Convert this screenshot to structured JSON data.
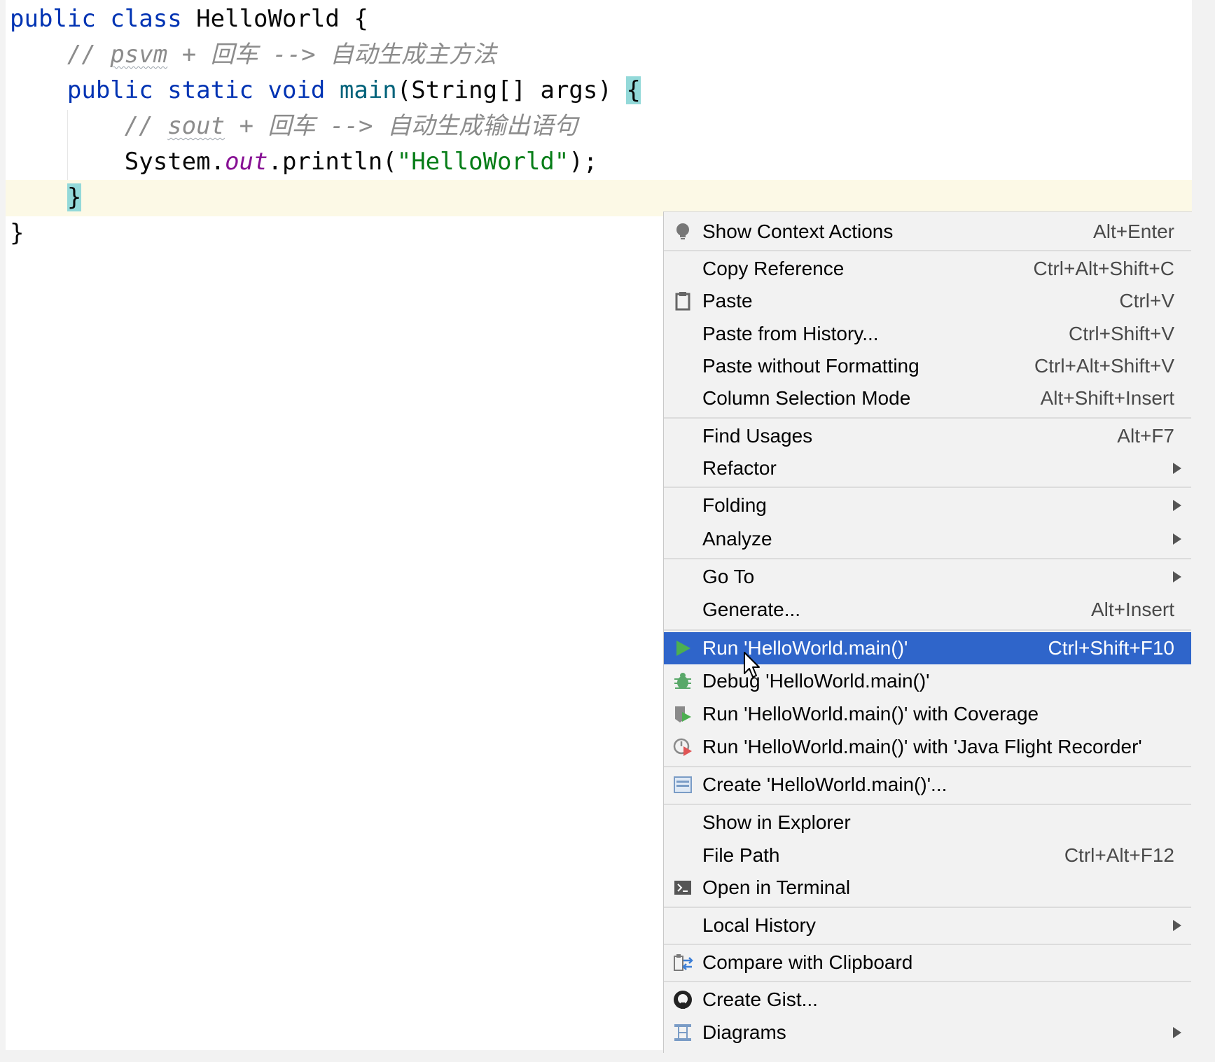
{
  "code": {
    "line1": {
      "kw1": "public",
      "kw2": "class",
      "name": "HelloWorld",
      "brace": "{"
    },
    "line2": {
      "slashes": "//",
      "word": "psvm",
      "plus": "+",
      "cjk1": "回车",
      "arrow": "-->",
      "cjk2": "自动生成主方法"
    },
    "line3": {
      "kw1": "public",
      "kw2": "static",
      "kw3": "void",
      "fn": "main",
      "params": "(String[] args)",
      "brace": "{"
    },
    "line4": {
      "slashes": "//",
      "word": "sout",
      "plus": "+",
      "cjk1": "回车",
      "arrow": "-->",
      "cjk2": "自动生成输出语句"
    },
    "line5": {
      "obj": "System.",
      "field": "out",
      "call": ".println(",
      "str": "\"HelloWorld\"",
      "end": ");"
    },
    "line6": {
      "brace": "}"
    },
    "line7": {
      "brace": "}"
    }
  },
  "context_menu": {
    "items": [
      {
        "label": "Show Context Actions",
        "shortcut": "Alt+Enter",
        "icon": "lightbulb-icon"
      },
      {
        "label": "Copy Reference",
        "shortcut": "Ctrl+Alt+Shift+C"
      },
      {
        "label": "Paste",
        "shortcut": "Ctrl+V",
        "icon": "clipboard-icon"
      },
      {
        "label": "Paste from History...",
        "shortcut": "Ctrl+Shift+V"
      },
      {
        "label": "Paste without Formatting",
        "shortcut": "Ctrl+Alt+Shift+V"
      },
      {
        "label": "Column Selection Mode",
        "shortcut": "Alt+Shift+Insert"
      },
      {
        "label": "Find Usages",
        "shortcut": "Alt+F7"
      },
      {
        "label": "Refactor",
        "submenu": true
      },
      {
        "label": "Folding",
        "submenu": true
      },
      {
        "label": "Analyze",
        "submenu": true
      },
      {
        "label": "Go To",
        "submenu": true
      },
      {
        "label": "Generate...",
        "shortcut": "Alt+Insert"
      },
      {
        "label": "Run 'HelloWorld.main()'",
        "shortcut": "Ctrl+Shift+F10",
        "icon": "run-icon",
        "selected": true
      },
      {
        "label": "Debug 'HelloWorld.main()'",
        "icon": "debug-bug-icon"
      },
      {
        "label": "Run 'HelloWorld.main()' with Coverage",
        "icon": "coverage-icon"
      },
      {
        "label": "Run 'HelloWorld.main()' with 'Java Flight Recorder'",
        "icon": "flight-recorder-icon"
      },
      {
        "label": "Create 'HelloWorld.main()'...",
        "icon": "run-config-icon"
      },
      {
        "label": "Show in Explorer"
      },
      {
        "label": "File Path",
        "shortcut": "Ctrl+Alt+F12"
      },
      {
        "label": "Open in Terminal",
        "icon": "terminal-icon"
      },
      {
        "label": "Local History",
        "submenu": true
      },
      {
        "label": "Compare with Clipboard",
        "icon": "compare-icon"
      },
      {
        "label": "Create Gist...",
        "icon": "github-icon"
      },
      {
        "label": "Diagrams",
        "submenu": true,
        "icon": "diagram-icon"
      }
    ]
  },
  "colors": {
    "menu_background": "#f2f2f2",
    "selection": "#2f65ca",
    "keyword": "#0033b3",
    "string": "#067d17",
    "comment": "#8c8c8c",
    "brace_match": "#93d9d9"
  }
}
